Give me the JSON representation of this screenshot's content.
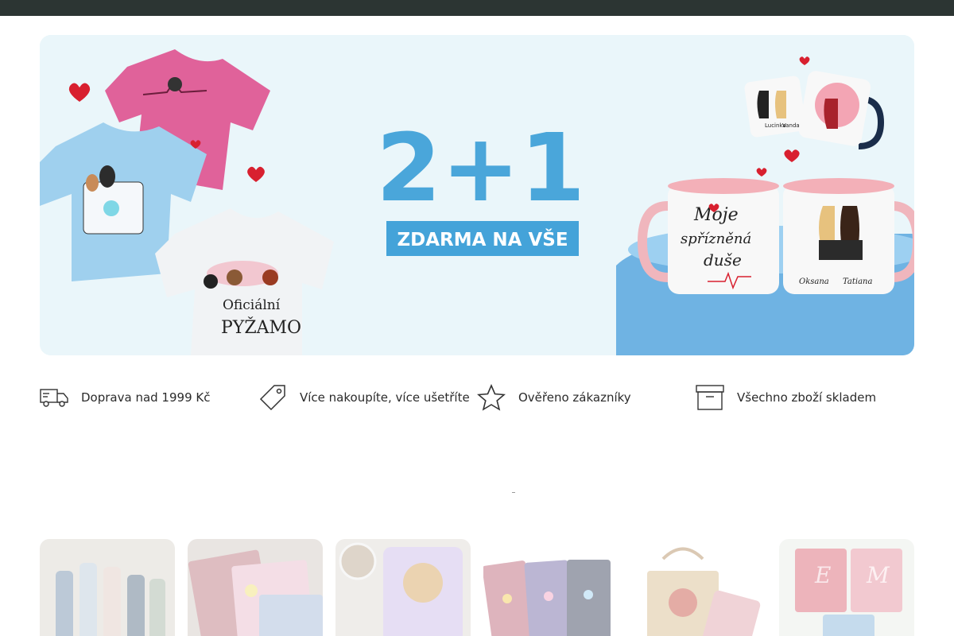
{
  "hero": {
    "promo_main": "2+1",
    "promo_sub": "ZDARMA NA VŠE",
    "shirt_text_line1": "Oficiální",
    "shirt_text_line2": "PYŽAMO",
    "mug_text_line1": "Moje",
    "mug_text_line2": "spřízněná",
    "mug_text_line3": "duše",
    "mug_name_left": "Oksana",
    "mug_name_right": "Tatiana",
    "small_mug_name_left": "Lucinka",
    "small_mug_name_right": "Vanda",
    "colors": {
      "accent_blue": "#4aa6da",
      "banner_blue": "#44a3d9",
      "heart_red": "#d8202f",
      "pink_shirt": "#e0629a",
      "blue_shirt": "#9fd0ee"
    }
  },
  "features": [
    {
      "icon": "delivery-truck-icon",
      "label": "Doprava nad 1999 Kč"
    },
    {
      "icon": "price-tag-icon",
      "label": "Více nakoupíte, více ušetříte"
    },
    {
      "icon": "star-icon",
      "label": "Ověřeno zákazníky"
    },
    {
      "icon": "archive-box-icon",
      "label": "Všechno zboží skladem"
    }
  ],
  "category_cards": [
    {
      "name": "bottles"
    },
    {
      "name": "notebooks"
    },
    {
      "name": "dog-mug"
    },
    {
      "name": "flower-notebooks"
    },
    {
      "name": "tote-bag"
    },
    {
      "name": "monogram-notebooks"
    }
  ]
}
